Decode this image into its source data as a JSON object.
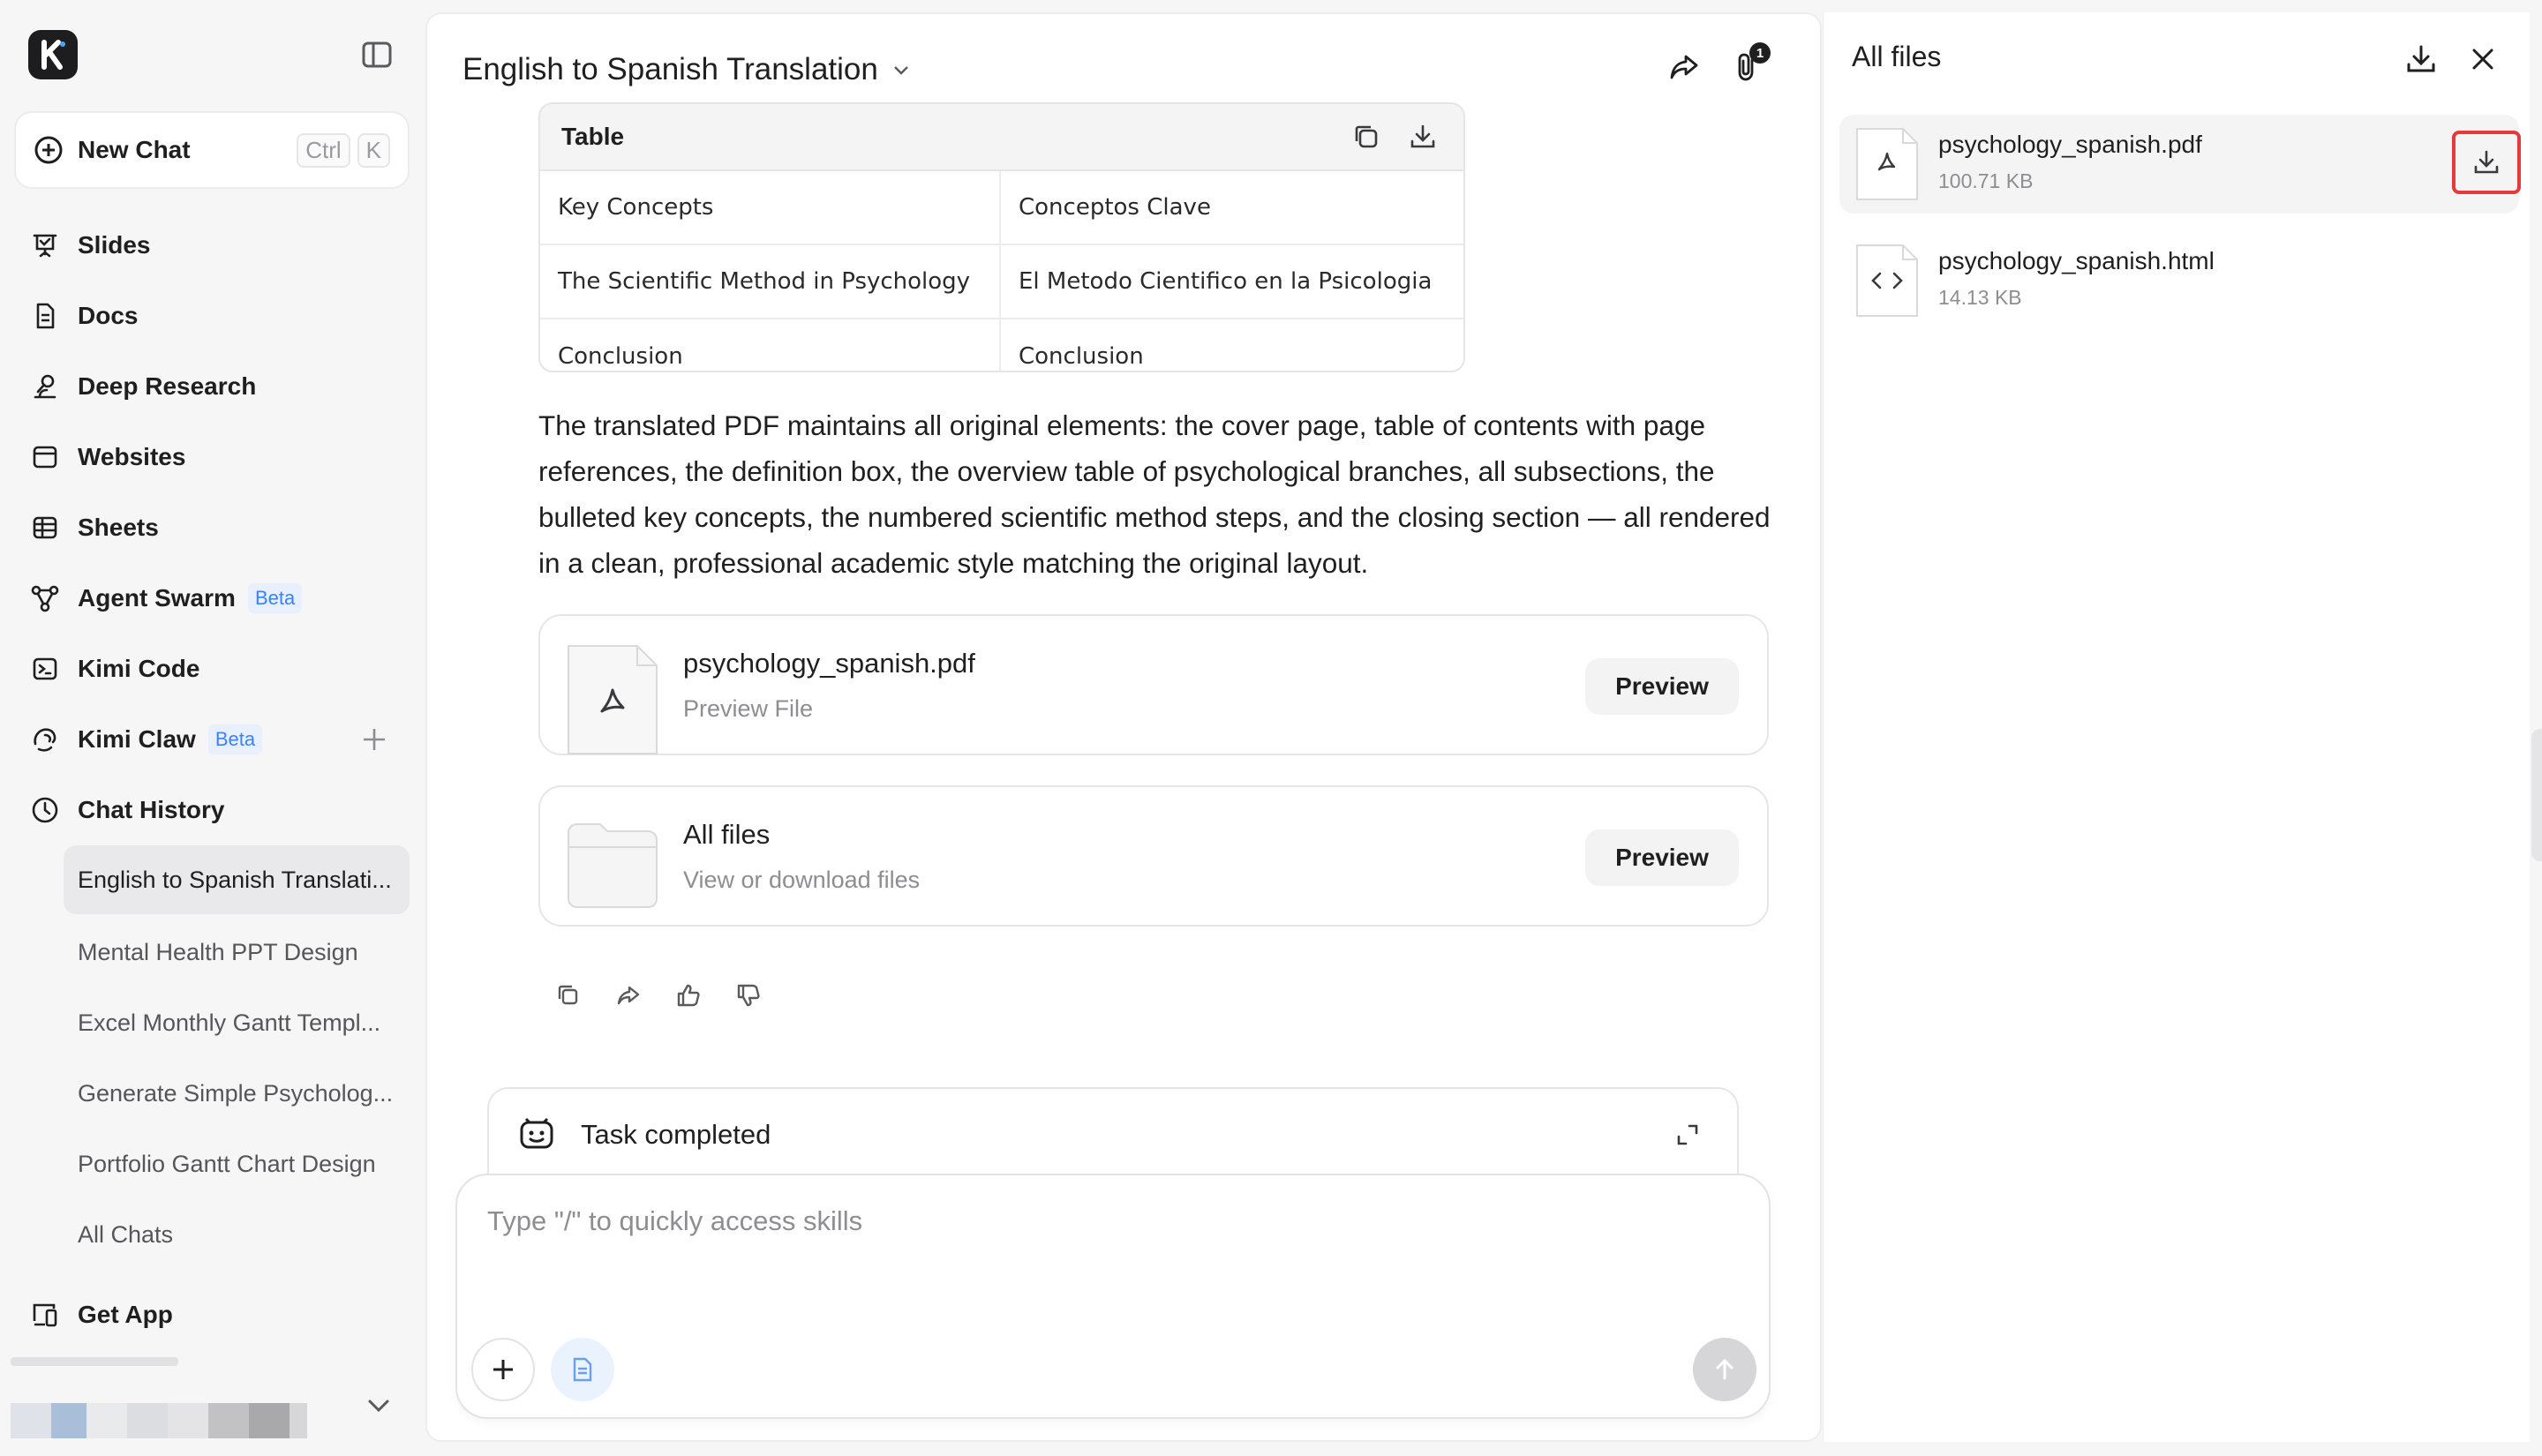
{
  "sidebar": {
    "new_chat": {
      "label": "New Chat",
      "shortcut_ctrl": "Ctrl",
      "shortcut_key": "K"
    },
    "nav": [
      {
        "label": "Slides",
        "icon": "presentation-icon"
      },
      {
        "label": "Docs",
        "icon": "document-icon"
      },
      {
        "label": "Deep Research",
        "icon": "research-icon"
      },
      {
        "label": "Websites",
        "icon": "browser-window-icon"
      },
      {
        "label": "Sheets",
        "icon": "table-grid-icon"
      },
      {
        "label": "Agent Swarm",
        "icon": "swarm-icon",
        "badge": "Beta"
      },
      {
        "label": "Kimi Code",
        "icon": "terminal-icon"
      },
      {
        "label": "Kimi Claw",
        "icon": "claw-icon",
        "badge": "Beta"
      },
      {
        "label": "Chat History",
        "icon": "clock-icon"
      }
    ],
    "history": [
      "English to Spanish Translati...",
      "Mental Health PPT Design",
      "Excel Monthly Gantt Templ...",
      "Generate Simple Psycholog...",
      "Portfolio Gantt Chart Design",
      "All Chats"
    ],
    "get_app": "Get App"
  },
  "main": {
    "title": "English to Spanish Translation",
    "attachment_count": "1",
    "table": {
      "heading": "Table",
      "rows": [
        [
          "Key Concepts",
          "Conceptos Clave"
        ],
        [
          "The Scientific Method in Psychology",
          "El Metodo Cientifico en la Psicologia"
        ],
        [
          "Conclusion",
          "Conclusion"
        ]
      ]
    },
    "paragraph": "The translated PDF maintains all original elements: the cover page, table of contents with page references, the definition box, the overview table of psychological branches, all subsections, the bulleted key concepts, the numbered scientific method steps, and the closing section — all rendered in a clean, professional academic style matching the original layout.",
    "cards": [
      {
        "name": "psychology_spanish.pdf",
        "sub": "Preview File",
        "button": "Preview"
      },
      {
        "name": "All files",
        "sub": "View or download files",
        "button": "Preview"
      }
    ],
    "task_status": "Task completed",
    "composer_placeholder": "Type \"/\" to quickly access skills"
  },
  "files_panel": {
    "title": "All files",
    "files": [
      {
        "name": "psychology_spanish.pdf",
        "size": "100.71 KB"
      },
      {
        "name": "psychology_spanish.html",
        "size": "14.13 KB"
      }
    ]
  },
  "colors": {
    "highlight": "#e5393b",
    "beta": "#3b82f6"
  }
}
